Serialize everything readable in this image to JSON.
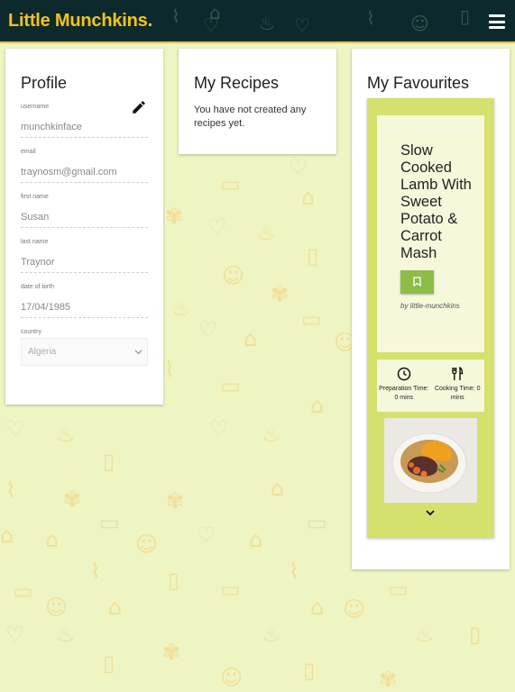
{
  "header": {
    "brand": "Little Munchkins."
  },
  "profile": {
    "title": "Profile",
    "fields": [
      {
        "label": "username",
        "value": "munchkinface"
      },
      {
        "label": "email",
        "value": "traynosm@gmail.com"
      },
      {
        "label": "first name",
        "value": "Susan"
      },
      {
        "label": "last name",
        "value": "Traynor"
      },
      {
        "label": "date of birth",
        "value": "17/04/1985"
      }
    ],
    "country": {
      "label": "country",
      "value": "Algeria"
    }
  },
  "recipes": {
    "title": "My Recipes",
    "empty_text": "You have not created any recipes yet."
  },
  "favourites": {
    "title": "My Favourites",
    "items": [
      {
        "title": "Slow Cooked Lamb With Sweet Potato & Carrot Mash",
        "by": "by little-munchkins",
        "prep": "Preparation Time: 0 mins",
        "cook": "Cooking Time: 0 mins"
      }
    ]
  },
  "colors": {
    "header_bg": "#0c2a2c",
    "brand": "#f6c21c",
    "page_bg": "#eef4c2",
    "fav_card_bg": "#d5e06d",
    "bookmark_button": "#8cbd48"
  },
  "icons": [
    "hamburger-menu-icon",
    "pencil-edit-icon",
    "chevron-down-icon",
    "bookmark-icon",
    "clock-icon",
    "fork-knife-icon",
    "chevron-down-icon"
  ]
}
